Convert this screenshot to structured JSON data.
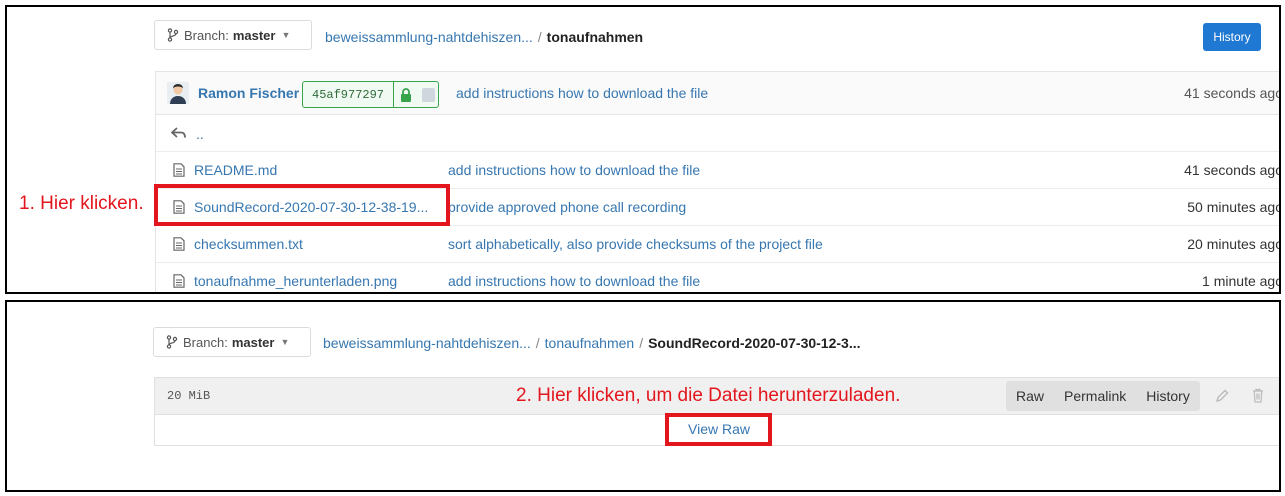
{
  "panel1": {
    "branch": {
      "label": "Branch:",
      "name": "master"
    },
    "breadcrumb": {
      "project": "beweissammlung-nahtdehiszen...",
      "folder": "tonaufnahmen"
    },
    "history_button": "History",
    "commit": {
      "author": "Ramon Fischer",
      "sha": "45af977297",
      "message": "add instructions how to download the file",
      "time": "41 seconds ago"
    },
    "parent_dir": "..",
    "files": [
      {
        "name": "README.md",
        "message": "add instructions how to download the file",
        "time": "41 seconds ago"
      },
      {
        "name": "SoundRecord-2020-07-30-12-38-19...",
        "message": "provide approved phone call recording",
        "time": "50 minutes ago"
      },
      {
        "name": "checksummen.txt",
        "message": "sort alphabetically, also provide checksums of the project file",
        "time": "20 minutes ago"
      },
      {
        "name": "tonaufnahme_herunterladen.png",
        "message": "add instructions how to download the file",
        "time": "1 minute ago"
      }
    ],
    "annotation": "1. Hier klicken."
  },
  "panel2": {
    "branch": {
      "label": "Branch:",
      "name": "master"
    },
    "breadcrumb": {
      "project": "beweissammlung-nahtdehiszen...",
      "folder": "tonaufnahmen",
      "file": "SoundRecord-2020-07-30-12-3..."
    },
    "file_size": "20 MiB",
    "actions": {
      "raw": "Raw",
      "permalink": "Permalink",
      "history": "History"
    },
    "view_raw": "View Raw",
    "annotation": "2. Hier klicken, um die Datei herunterzuladen."
  },
  "colors": {
    "link": "#3777b0",
    "accent": "#1f78d1",
    "annotation": "#e3161d",
    "sha_border": "#37a34a"
  },
  "icons": {
    "branch": "git-branch-icon",
    "file": "file-icon",
    "up": "reply-arrow-icon",
    "lock": "lock-icon",
    "edit": "pencil-icon",
    "delete": "trash-icon"
  }
}
